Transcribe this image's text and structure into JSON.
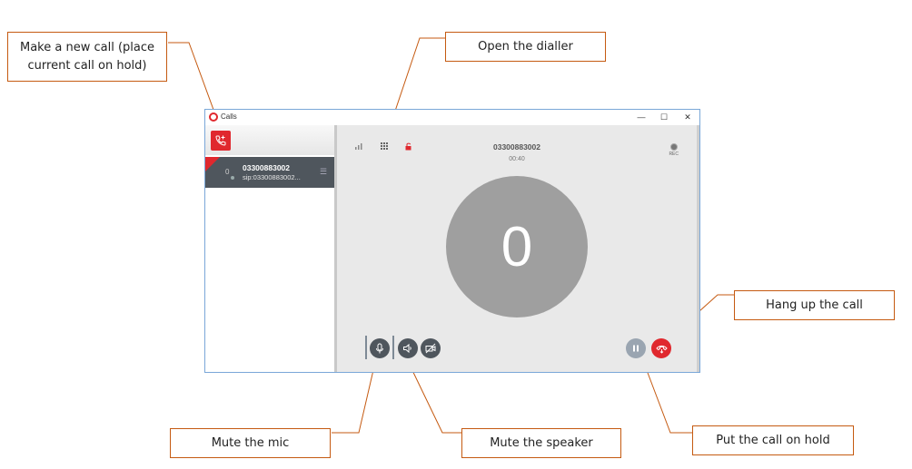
{
  "window": {
    "title": "Calls",
    "controls": {
      "minimize": "—",
      "maximize": "☐",
      "close": "✕"
    }
  },
  "sidebar": {
    "calls": [
      {
        "avatar_initial": "0",
        "number": "03300883002",
        "uri": "sip:03300883002...",
        "menu_icon": "☰"
      }
    ]
  },
  "call": {
    "number": "03300883002",
    "duration": "00:40",
    "avatar_text": "0",
    "rec_label": "REC"
  },
  "callouts": {
    "new_call": "Make a new call (place current call on hold)",
    "dialler": "Open the dialler",
    "hang_up": "Hang up the call",
    "mute_mic": "Mute the mic",
    "mute_speaker": "Mute the speaker",
    "hold": "Put the call on hold"
  },
  "colors": {
    "accent_red": "#e0282e",
    "sidebar_active": "#4f565d",
    "callout_border": "#c55a11",
    "main_bg": "#e9e9e9",
    "avatar_bg": "#9f9f9f",
    "hold_btn": "#9aa5b1"
  },
  "icons": {
    "new_call": "phone-plus-icon",
    "signal": "signal-bars-icon",
    "dialpad": "dialpad-icon",
    "lock": "unlocked-padlock-icon",
    "rec": "record-icon",
    "mic": "microphone-icon",
    "speaker": "speaker-icon",
    "video": "video-off-icon",
    "hold": "pause-icon",
    "hangup": "hangup-icon"
  }
}
